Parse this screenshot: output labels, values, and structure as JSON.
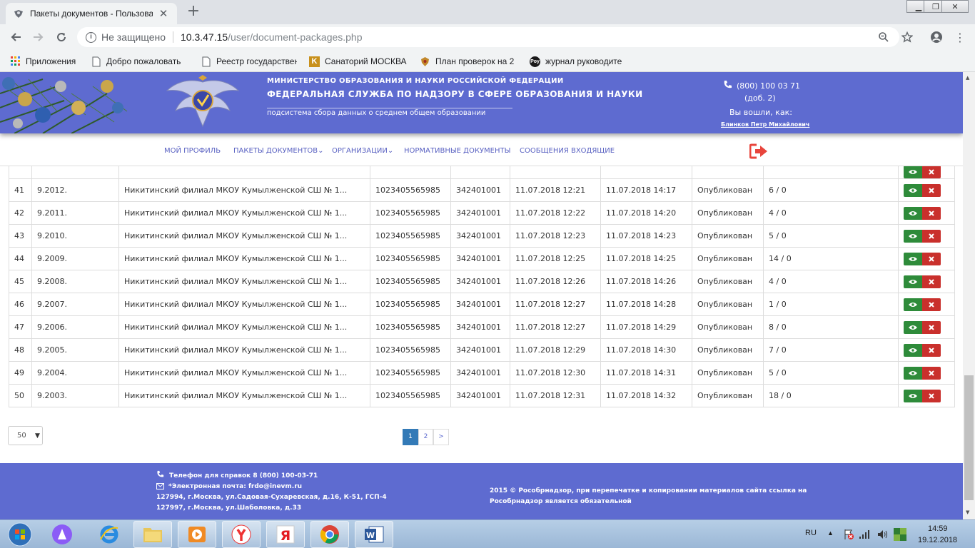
{
  "browser": {
    "tab_title": "Пакеты документов - Пользова",
    "security_label": "Не защищено",
    "url_host": "10.3.47.15",
    "url_path": "/user/document-packages.php",
    "bookmarks": [
      {
        "label": "Приложения",
        "icon": "apps-grid-icon"
      },
      {
        "label": "Добро пожаловать",
        "icon": "page-icon"
      },
      {
        "label": "Реестр государствен",
        "icon": "page-icon"
      },
      {
        "label": "Санаторий МОСКВА",
        "icon": "k-logo-icon"
      },
      {
        "label": "План проверок на 2",
        "icon": "emblem-icon"
      },
      {
        "label": "журнал руководите",
        "icon": "poy-icon"
      }
    ]
  },
  "header": {
    "ministry": "МИНИСТЕРСТВО ОБРАЗОВАНИЯ И НАУКИ РОССИЙСКОЙ ФЕДЕРАЦИИ",
    "service": "ФЕДЕРАЛЬНАЯ СЛУЖБА ПО НАДЗОРУ В СФЕРЕ ОБРАЗОВАНИЯ И НАУКИ",
    "subsystem": "подсистема сбора данных о среднем общем образовании",
    "phone": "(800) 100 03 71",
    "ext": "(доб. 2)",
    "logged_in_label": "Вы вошли, как:",
    "user_name": "Блинков Петр Михайлович"
  },
  "nav": {
    "profile": "Мой профиль",
    "packages": "Пакеты документов",
    "orgs": "Организации",
    "normative": "Нормативные документы",
    "messages": "Сообщения входящие"
  },
  "rows": [
    {
      "n": "41",
      "code": "9.2012.",
      "org": "Никитинский филиал МКОУ Кумылженской СШ № 1...",
      "ogrn": "1023405565985",
      "kpp": "342401001",
      "created": "11.07.2018 12:21",
      "updated": "11.07.2018 14:17",
      "status": "Опубликован",
      "count": "6 / 0"
    },
    {
      "n": "42",
      "code": "9.2011.",
      "org": "Никитинский филиал МКОУ Кумылженской СШ № 1...",
      "ogrn": "1023405565985",
      "kpp": "342401001",
      "created": "11.07.2018 12:22",
      "updated": "11.07.2018 14:20",
      "status": "Опубликован",
      "count": "4 / 0"
    },
    {
      "n": "43",
      "code": "9.2010.",
      "org": "Никитинский филиал МКОУ Кумылженской СШ № 1...",
      "ogrn": "1023405565985",
      "kpp": "342401001",
      "created": "11.07.2018 12:23",
      "updated": "11.07.2018 14:23",
      "status": "Опубликован",
      "count": "5 / 0"
    },
    {
      "n": "44",
      "code": "9.2009.",
      "org": "Никитинский филиал МКОУ Кумылженской СШ № 1...",
      "ogrn": "1023405565985",
      "kpp": "342401001",
      "created": "11.07.2018 12:25",
      "updated": "11.07.2018 14:25",
      "status": "Опубликован",
      "count": "14 / 0"
    },
    {
      "n": "45",
      "code": "9.2008.",
      "org": "Никитинский филиал МКОУ Кумылженской СШ № 1...",
      "ogrn": "1023405565985",
      "kpp": "342401001",
      "created": "11.07.2018 12:26",
      "updated": "11.07.2018 14:26",
      "status": "Опубликован",
      "count": "4 / 0"
    },
    {
      "n": "46",
      "code": "9.2007.",
      "org": "Никитинский филиал МКОУ Кумылженской СШ № 1...",
      "ogrn": "1023405565985",
      "kpp": "342401001",
      "created": "11.07.2018 12:27",
      "updated": "11.07.2018 14:28",
      "status": "Опубликован",
      "count": "1 / 0"
    },
    {
      "n": "47",
      "code": "9.2006.",
      "org": "Никитинский филиал МКОУ Кумылженской СШ № 1...",
      "ogrn": "1023405565985",
      "kpp": "342401001",
      "created": "11.07.2018 12:27",
      "updated": "11.07.2018 14:29",
      "status": "Опубликован",
      "count": "8 / 0"
    },
    {
      "n": "48",
      "code": "9.2005.",
      "org": "Никитинский филиал МКОУ Кумылженской СШ № 1...",
      "ogrn": "1023405565985",
      "kpp": "342401001",
      "created": "11.07.2018 12:29",
      "updated": "11.07.2018 14:30",
      "status": "Опубликован",
      "count": "7 / 0"
    },
    {
      "n": "49",
      "code": "9.2004.",
      "org": "Никитинский филиал МКОУ Кумылженской СШ № 1...",
      "ogrn": "1023405565985",
      "kpp": "342401001",
      "created": "11.07.2018 12:30",
      "updated": "11.07.2018 14:31",
      "status": "Опубликован",
      "count": "5 / 0"
    },
    {
      "n": "50",
      "code": "9.2003.",
      "org": "Никитинский филиал МКОУ Кумылженской СШ № 1...",
      "ogrn": "1023405565985",
      "kpp": "342401001",
      "created": "11.07.2018 12:31",
      "updated": "11.07.2018 14:32",
      "status": "Опубликован",
      "count": "18 / 0"
    }
  ],
  "pager": {
    "per_page": "50",
    "pages": [
      "1",
      "2",
      ">"
    ],
    "active": "1"
  },
  "footer": {
    "phone": "Телефон для справок 8 (800) 100-03-71",
    "email": "*Электронная почта: frdo@inevm.ru",
    "addr1": "127994, г.Москва, ул.Садовая-Сухаревская, д.16, К-51, ГСП-4",
    "addr2": "127997, г.Москва, ул.Шаболовка, д.33",
    "copyright1": "2015 © Рособрнадзор, при перепечатке и копировании материалов сайта ссылка на",
    "copyright2": "Рособрнадзор является обязательной"
  },
  "taskbar": {
    "lang": "RU",
    "time": "14:59",
    "date": "19.12.2018",
    "apps": [
      "start-orb-icon",
      "alice-icon",
      "ie-icon",
      "explorer-folder-icon",
      "media-player-icon",
      "yandex-browser-icon",
      "yandex-icon",
      "chrome-icon",
      "word-icon"
    ]
  },
  "colors": {
    "header_blue": "#5e6bd0",
    "view_green": "#2e8b3a",
    "delete_red": "#c9302c",
    "active_page": "#337ab7"
  }
}
